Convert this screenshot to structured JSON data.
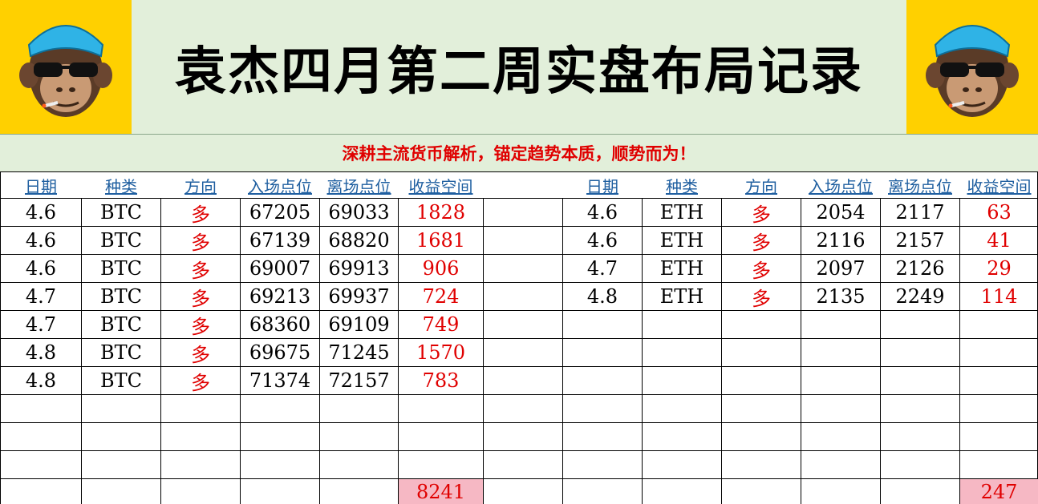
{
  "title": "袁杰四月第二周实盘布局记录",
  "subtitle": "深耕主流货币解析，锚定趋势本质，顺势而为！",
  "headers": [
    "日期",
    "种类",
    "方向",
    "入场点位",
    "离场点位",
    "收益空间"
  ],
  "btc": {
    "rows": [
      [
        "4.6",
        "BTC",
        "多",
        "67205",
        "69033",
        "1828"
      ],
      [
        "4.6",
        "BTC",
        "多",
        "67139",
        "68820",
        "1681"
      ],
      [
        "4.6",
        "BTC",
        "多",
        "69007",
        "69913",
        "906"
      ],
      [
        "4.7",
        "BTC",
        "多",
        "69213",
        "69937",
        "724"
      ],
      [
        "4.7",
        "BTC",
        "多",
        "68360",
        "69109",
        "749"
      ],
      [
        "4.8",
        "BTC",
        "多",
        "69675",
        "71245",
        "1570"
      ],
      [
        "4.8",
        "BTC",
        "多",
        "71374",
        "72157",
        "783"
      ]
    ],
    "total": "8241"
  },
  "eth": {
    "rows": [
      [
        "4.6",
        "ETH",
        "多",
        "2054",
        "2117",
        "63"
      ],
      [
        "4.6",
        "ETH",
        "多",
        "2116",
        "2157",
        "41"
      ],
      [
        "4.7",
        "ETH",
        "多",
        "2097",
        "2126",
        "29"
      ],
      [
        "4.8",
        "ETH",
        "多",
        "2135",
        "2249",
        "114"
      ]
    ],
    "total": "247"
  },
  "colors": {
    "header_bg": "#e2efda",
    "logo_bg": "#ffd000",
    "profit_red": "#e00000",
    "total_bg": "#f6b8c4",
    "header_link": "#1f5fa0"
  },
  "icons": {
    "logo": "monkey-sunglasses-logo-icon"
  }
}
